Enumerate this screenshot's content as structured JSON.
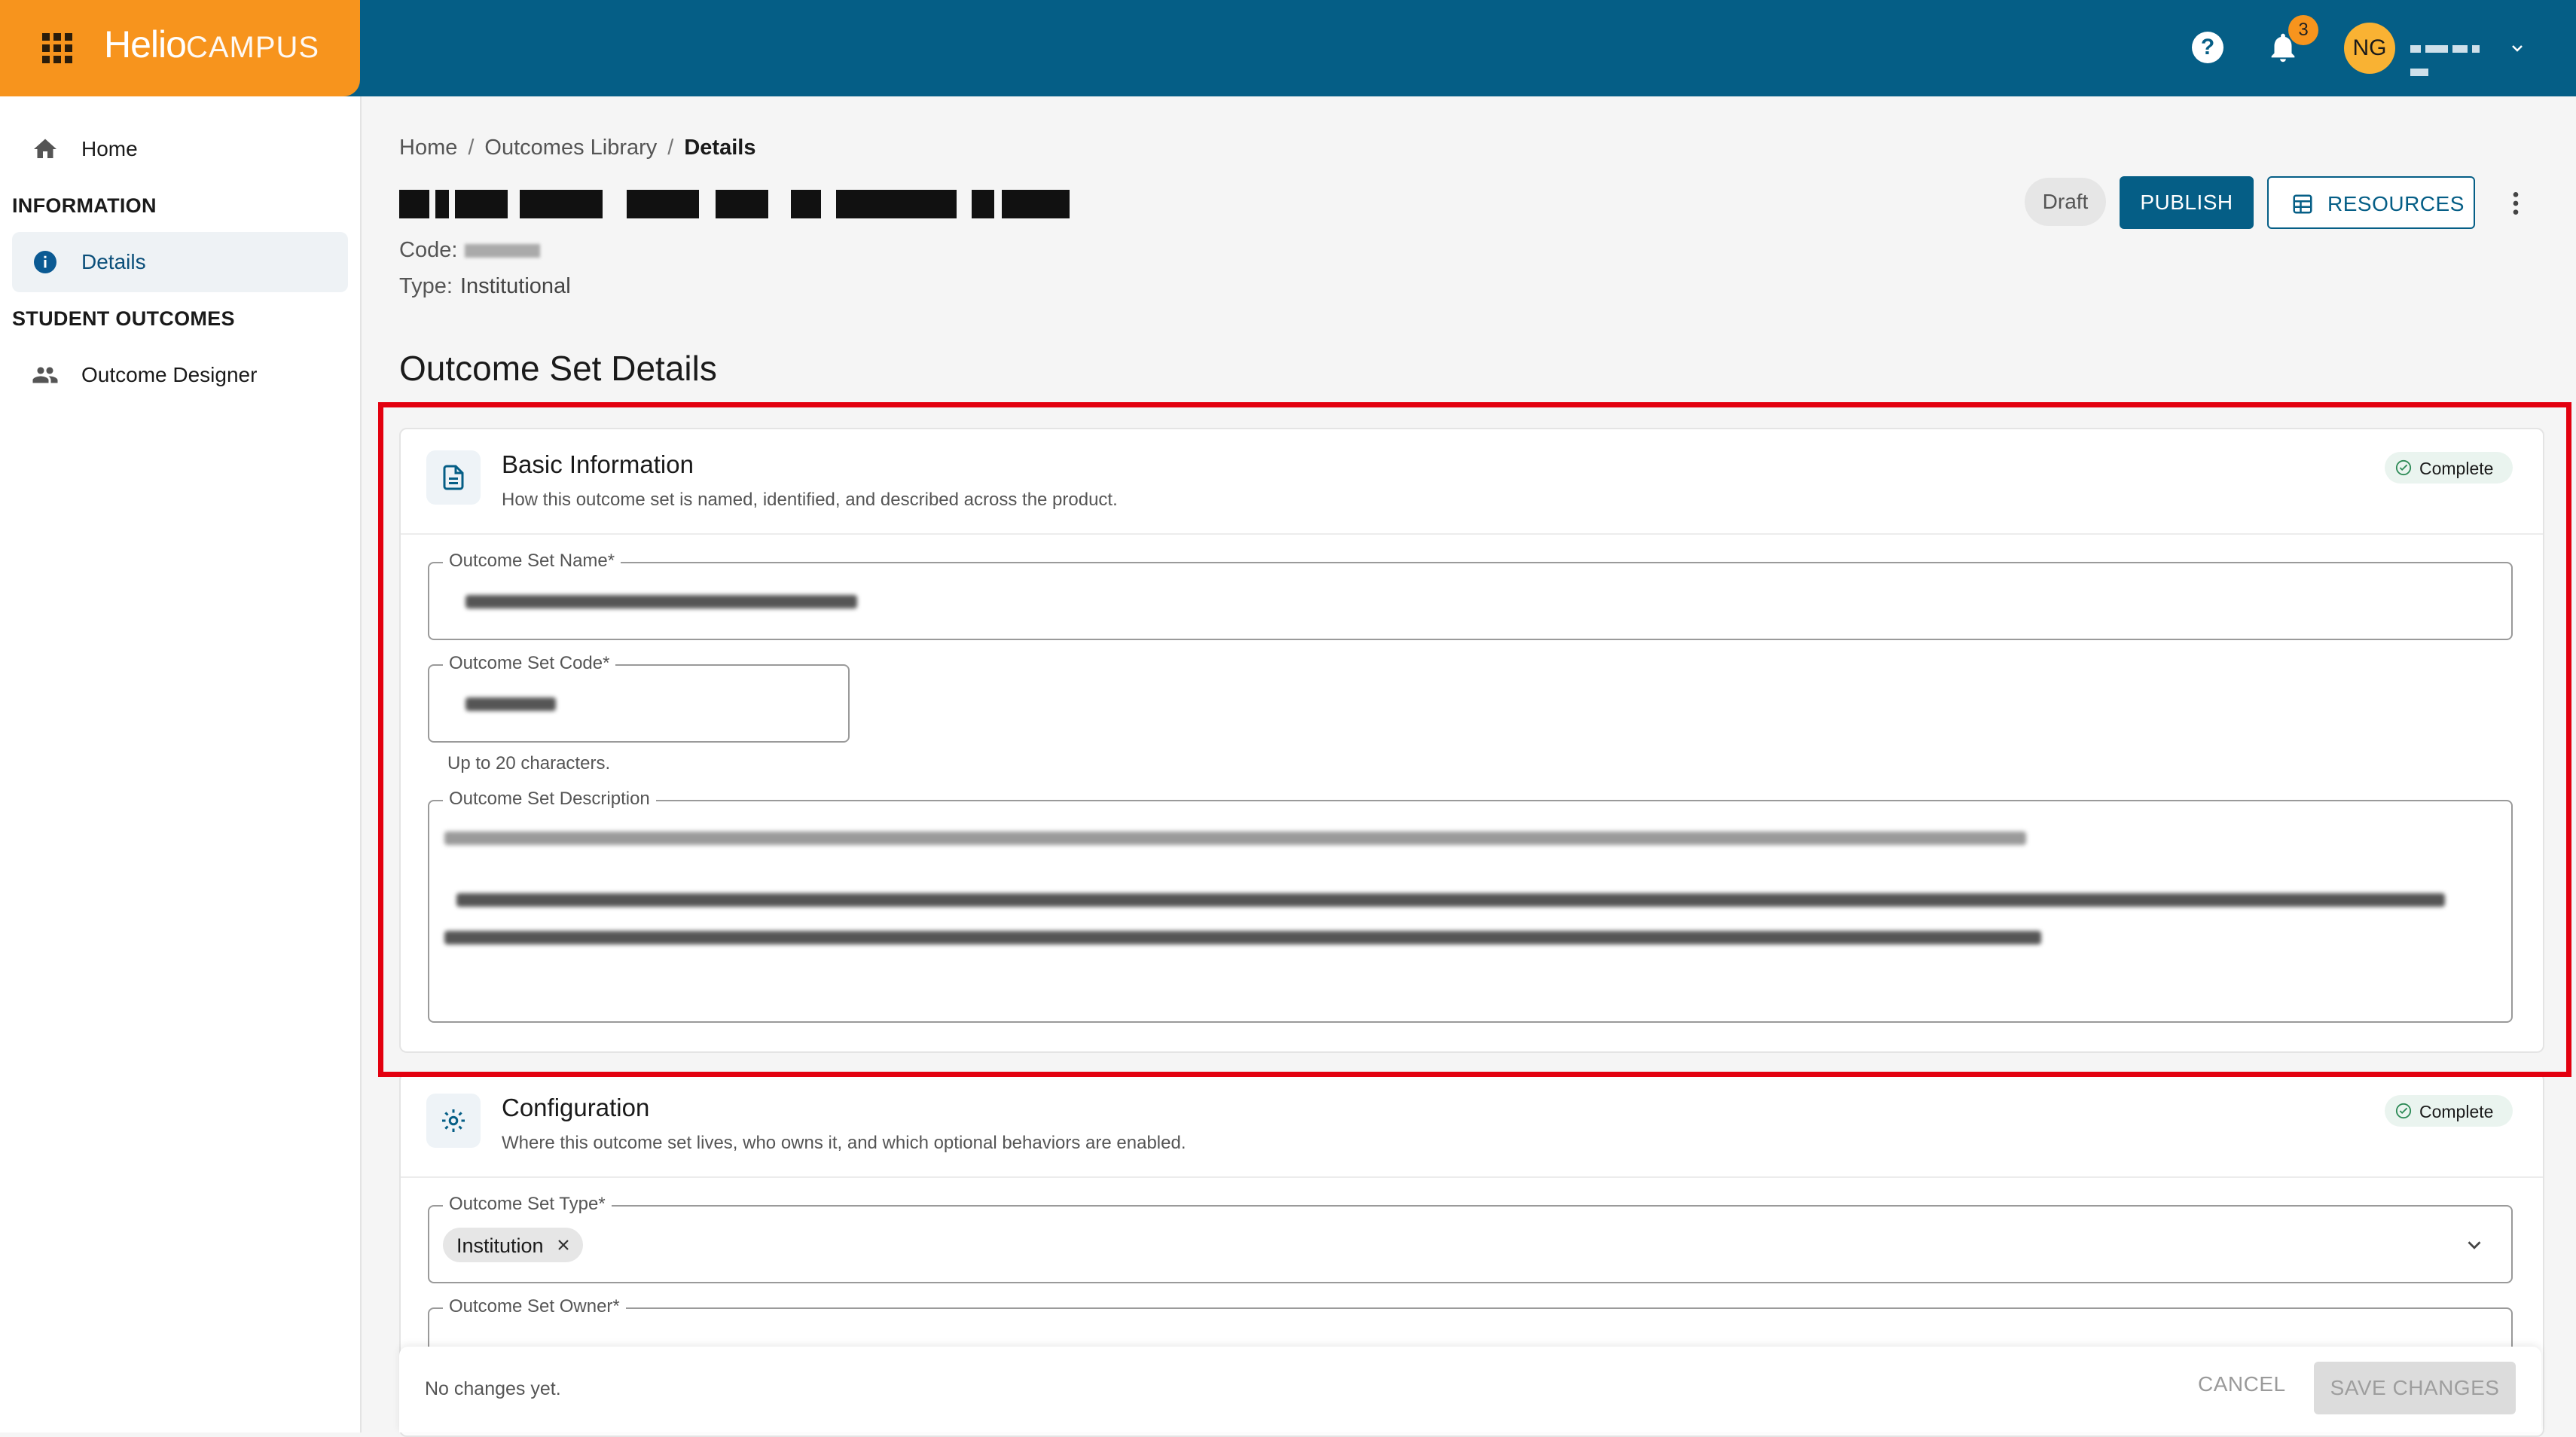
{
  "app": {
    "brand_main": "Helio",
    "brand_sub": "CAMPUS",
    "notification_count": "3",
    "user_initials": "NG"
  },
  "sidebar": {
    "home_label": "Home",
    "section_information": "INFORMATION",
    "details_label": "Details",
    "section_student_outcomes": "STUDENT OUTCOMES",
    "outcome_designer_label": "Outcome Designer"
  },
  "breadcrumb": {
    "home": "Home",
    "sep": "/",
    "library": "Outcomes Library",
    "current": "Details"
  },
  "header": {
    "code_label": "Code:",
    "type_label": "Type:",
    "type_value": "Institutional",
    "status": "Draft",
    "publish_label": "PUBLISH",
    "resources_label": "RESOURCES"
  },
  "main": {
    "section_title": "Outcome Set Details"
  },
  "basic_info": {
    "title": "Basic Information",
    "subtitle": "How this outcome set is named, identified, and described across the product.",
    "status": "Complete",
    "name_label": "Outcome Set Name",
    "code_label": "Outcome Set Code",
    "code_helper": "Up to 20 characters.",
    "description_label": "Outcome Set Description",
    "required_mark": "*"
  },
  "configuration": {
    "title": "Configuration",
    "subtitle": "Where this outcome set lives, who owns it, and which optional behaviors are enabled.",
    "status": "Complete",
    "type_label": "Outcome Set Type",
    "type_value": "Institution",
    "owner_label": "Outcome Set Owner",
    "required_mark": "*"
  },
  "footer": {
    "status": "No changes yet.",
    "cancel_label": "CANCEL",
    "save_label": "SAVE CHANGES"
  },
  "colors": {
    "primary": "#055e86",
    "brand_orange": "#f7941d",
    "highlight_red": "#e3000f"
  }
}
